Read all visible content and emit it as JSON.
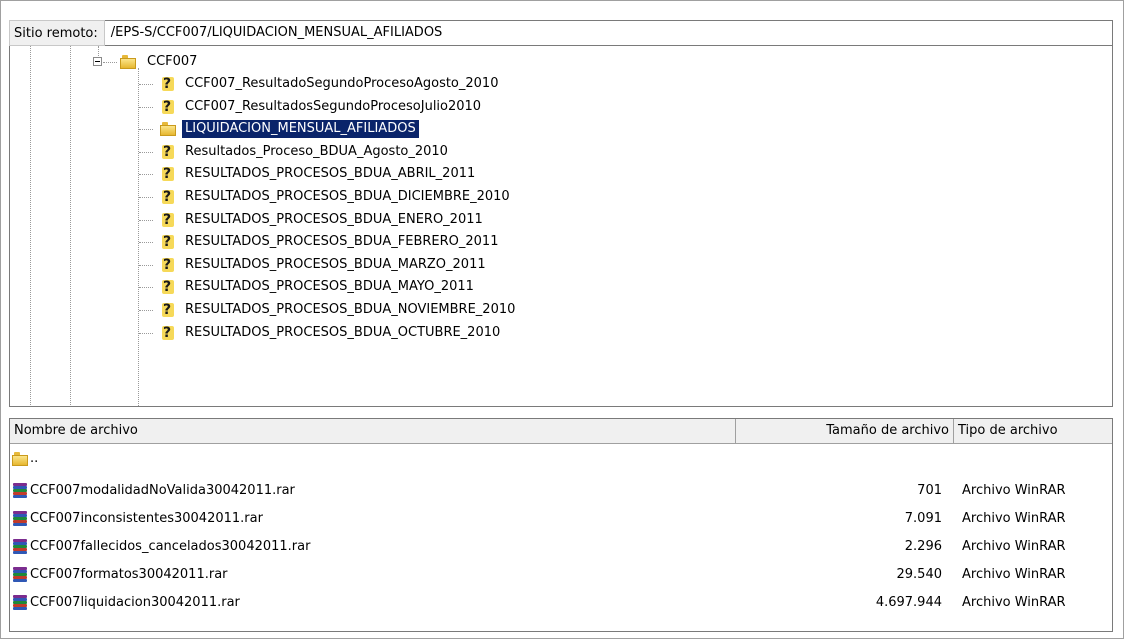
{
  "path_bar": {
    "label": "Sitio remoto:",
    "value": "/EPS-S/CCF007/LIQUIDACION_MENSUAL_AFILIADOS"
  },
  "tree": {
    "root": "CCF007",
    "items": [
      {
        "label": "CCF007_ResultadoSegundoProcesoAgosto_2010",
        "icon": "question-folder-icon"
      },
      {
        "label": "CCF007_ResultadosSegundoProcesoJulio2010",
        "icon": "question-folder-icon"
      },
      {
        "label": "LIQUIDACION_MENSUAL_AFILIADOS",
        "icon": "folder-icon",
        "selected": true
      },
      {
        "label": "Resultados_Proceso_BDUA_Agosto_2010",
        "icon": "question-folder-icon"
      },
      {
        "label": "RESULTADOS_PROCESOS_BDUA_ABRIL_2011",
        "icon": "question-folder-icon"
      },
      {
        "label": "RESULTADOS_PROCESOS_BDUA_DICIEMBRE_2010",
        "icon": "question-folder-icon"
      },
      {
        "label": "RESULTADOS_PROCESOS_BDUA_ENERO_2011",
        "icon": "question-folder-icon"
      },
      {
        "label": "RESULTADOS_PROCESOS_BDUA_FEBRERO_2011",
        "icon": "question-folder-icon"
      },
      {
        "label": "RESULTADOS_PROCESOS_BDUA_MARZO_2011",
        "icon": "question-folder-icon"
      },
      {
        "label": "RESULTADOS_PROCESOS_BDUA_MAYO_2011",
        "icon": "question-folder-icon"
      },
      {
        "label": "RESULTADOS_PROCESOS_BDUA_NOVIEMBRE_2010",
        "icon": "question-folder-icon"
      },
      {
        "label": "RESULTADOS_PROCESOS_BDUA_OCTUBRE_2010",
        "icon": "question-folder-icon"
      }
    ]
  },
  "file_list": {
    "columns": {
      "name": "Nombre de archivo",
      "size": "Tamaño de archivo",
      "type": "Tipo de archivo"
    },
    "parent": "..",
    "files": [
      {
        "name": "CCF007modalidadNoValida30042011.rar",
        "size": "701",
        "type": "Archivo WinRAR"
      },
      {
        "name": "CCF007inconsistentes30042011.rar",
        "size": "7.091",
        "type": "Archivo WinRAR"
      },
      {
        "name": "CCF007fallecidos_cancelados30042011.rar",
        "size": "2.296",
        "type": "Archivo WinRAR"
      },
      {
        "name": "CCF007formatos30042011.rar",
        "size": "29.540",
        "type": "Archivo WinRAR"
      },
      {
        "name": "CCF007liquidacion30042011.rar",
        "size": "4.697.944",
        "type": "Archivo WinRAR"
      }
    ]
  },
  "colors": {
    "selection": "#0a246a",
    "folder": "#f5d23c"
  }
}
